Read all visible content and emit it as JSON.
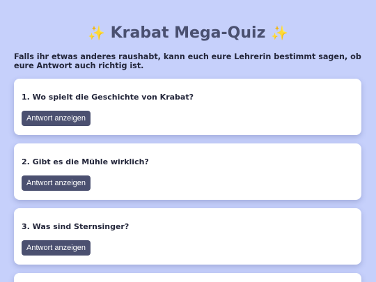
{
  "header": {
    "title": "Krabat Mega-Quiz",
    "sparkle_left": "✨",
    "sparkle_right": "✨"
  },
  "intro": "Falls ihr etwas anderes raushabt, kann euch eure Lehrerin bestimmt sagen, ob eure Antwort auch richtig ist.",
  "questions": [
    {
      "text": "1. Wo spielt die Geschichte von Krabat?",
      "button_label": "Antwort anzeigen"
    },
    {
      "text": "2. Gibt es die Mühle wirklich?",
      "button_label": "Antwort anzeigen"
    },
    {
      "text": "3. Was sind Sternsinger?",
      "button_label": "Antwort anzeigen"
    }
  ],
  "colors": {
    "background": "#c6d0fb",
    "title": "#4a5070",
    "button": "#4b5070",
    "card": "#ffffff"
  }
}
